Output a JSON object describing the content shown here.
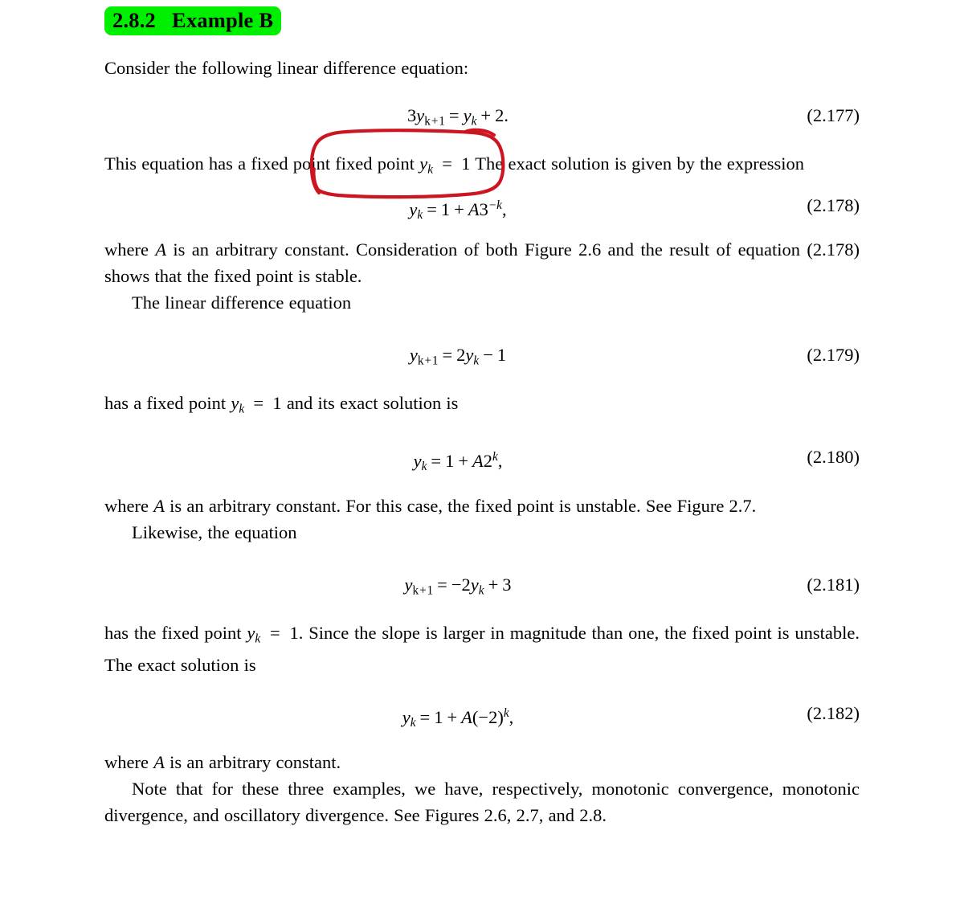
{
  "document": {
    "type": "textbook-page",
    "background_color": "#ffffff",
    "text_color": "#000000"
  },
  "heading": {
    "number": "2.8.2",
    "title": "Example B",
    "highlight_color": "#00ee00"
  },
  "paragraphs": {
    "intro": "Consider the following linear difference equation:",
    "after_177_a": "This equation has a fixed point ",
    "after_177_b": " The exact solution is given by the expression",
    "after_178": "where A is an arbitrary constant. Consideration of both Figure 2.6 and the result of equation (2.178) shows that the fixed point is stable.",
    "after_178_indented": "The linear difference equation",
    "after_179": "has a fixed point y_k = 1 and its exact solution is",
    "after_180": "where A is an arbitrary constant. For this case, the fixed point is unstable. See Figure 2.7.",
    "after_180_indented": "Likewise, the equation",
    "after_181": "has the fixed point y_k = 1. Since the slope is larger in magnitude than one, the fixed point is unstable. The exact solution is",
    "after_182": "where A is an arbitrary constant.",
    "closing": "Note that for these three examples, we have, respectively, monotonic convergence, monotonic divergence, and oscillatory divergence. See Figures 2.6, 2.7, and 2.8."
  },
  "equations": [
    {
      "id": "eq-2-177",
      "latex": "3y_{k+1} = y_k + 2.",
      "number": "(2.177)"
    },
    {
      "id": "eq-2-178",
      "latex": "y_k = 1 + A3^{-k},",
      "number": "(2.178)"
    },
    {
      "id": "eq-2-179",
      "latex": "y_{k+1} = 2y_k - 1",
      "number": "(2.179)"
    },
    {
      "id": "eq-2-180",
      "latex": "y_k = 1 + A2^{k},",
      "number": "(2.180)"
    },
    {
      "id": "eq-2-181",
      "latex": "y_{k+1} = -2y_k + 3",
      "number": "(2.181)"
    },
    {
      "id": "eq-2-182",
      "latex": "y_k = 1 + A(-2)^{k},",
      "number": "(2.182)"
    }
  ],
  "annotation": {
    "type": "hand-drawn-circle",
    "color": "#cc1520",
    "encircled_text": "fixed point y_k = 1"
  }
}
